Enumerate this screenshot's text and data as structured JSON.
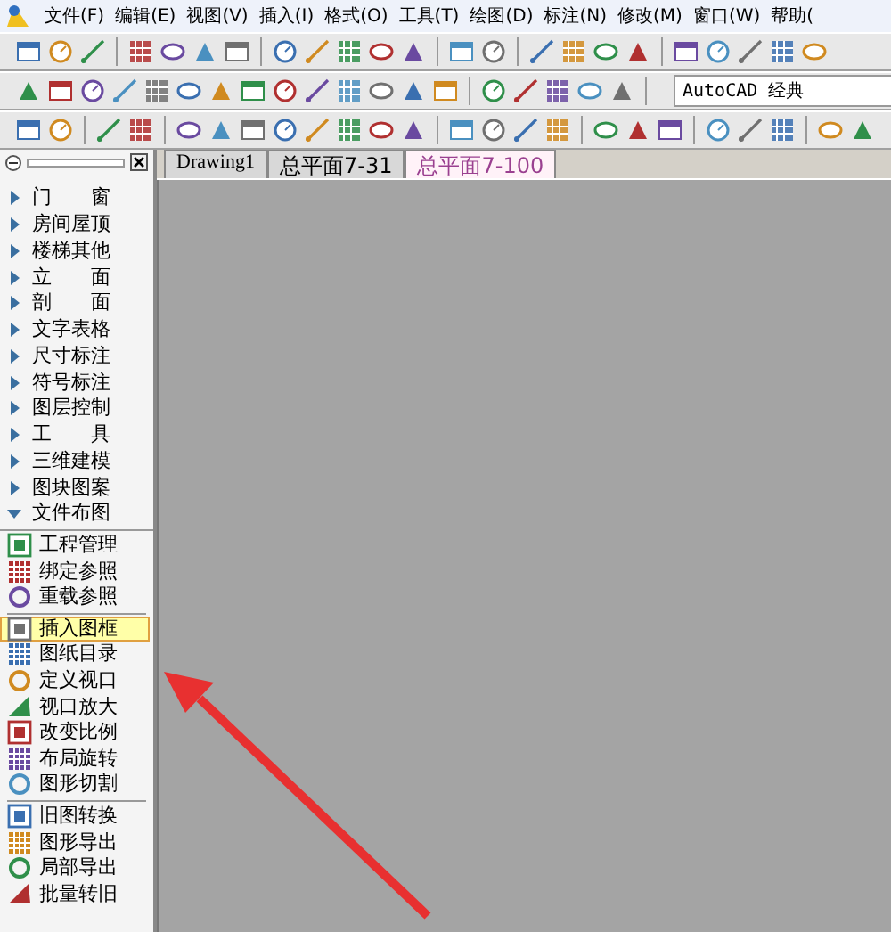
{
  "menu_bar": {
    "items": [
      "文件(F)",
      "编辑(E)",
      "视图(V)",
      "插入(I)",
      "格式(O)",
      "工具(T)",
      "绘图(D)",
      "标注(N)",
      "修改(M)",
      "窗口(W)",
      "帮助("
    ]
  },
  "toolbar": {
    "workspace": "AutoCAD 经典"
  },
  "tabs": [
    {
      "label": "Drawing1",
      "selected": false
    },
    {
      "label": "总平面7-31",
      "selected": false
    },
    {
      "label": "总平面7-100",
      "selected": true
    }
  ],
  "sidebar": {
    "items": [
      {
        "label": "门　　窗",
        "expanded": false
      },
      {
        "label": "房间屋顶",
        "expanded": false
      },
      {
        "label": "楼梯其他",
        "expanded": false
      },
      {
        "label": "立　　面",
        "expanded": false
      },
      {
        "label": "剖　　面",
        "expanded": false
      },
      {
        "label": "文字表格",
        "expanded": false
      },
      {
        "label": "尺寸标注",
        "expanded": false
      },
      {
        "label": "符号标注",
        "expanded": false
      },
      {
        "label": "图层控制",
        "expanded": false
      },
      {
        "label": "工　　具",
        "expanded": false
      },
      {
        "label": "三维建模",
        "expanded": false
      },
      {
        "label": "图块图案",
        "expanded": false
      },
      {
        "label": "文件布图",
        "expanded": true,
        "children": [
          {
            "kind": "item",
            "label": "工程管理",
            "selected": false
          },
          {
            "kind": "item",
            "label": "绑定参照",
            "selected": false
          },
          {
            "kind": "item",
            "label": "重载参照",
            "selected": false
          },
          {
            "kind": "separator"
          },
          {
            "kind": "item",
            "label": "插入图框",
            "selected": true
          },
          {
            "kind": "item",
            "label": "图纸目录",
            "selected": false
          },
          {
            "kind": "item",
            "label": "定义视口",
            "selected": false
          },
          {
            "kind": "item",
            "label": "视口放大",
            "selected": false
          },
          {
            "kind": "item",
            "label": "改变比例",
            "selected": false
          },
          {
            "kind": "item",
            "label": "布局旋转",
            "selected": false
          },
          {
            "kind": "item",
            "label": "图形切割",
            "selected": false
          },
          {
            "kind": "separator"
          },
          {
            "kind": "item",
            "label": "旧图转换",
            "selected": false
          },
          {
            "kind": "item",
            "label": "图形导出",
            "selected": false
          },
          {
            "kind": "item",
            "label": "局部导出",
            "selected": false
          },
          {
            "kind": "item",
            "label": "批量转旧",
            "selected": false
          }
        ]
      }
    ]
  }
}
